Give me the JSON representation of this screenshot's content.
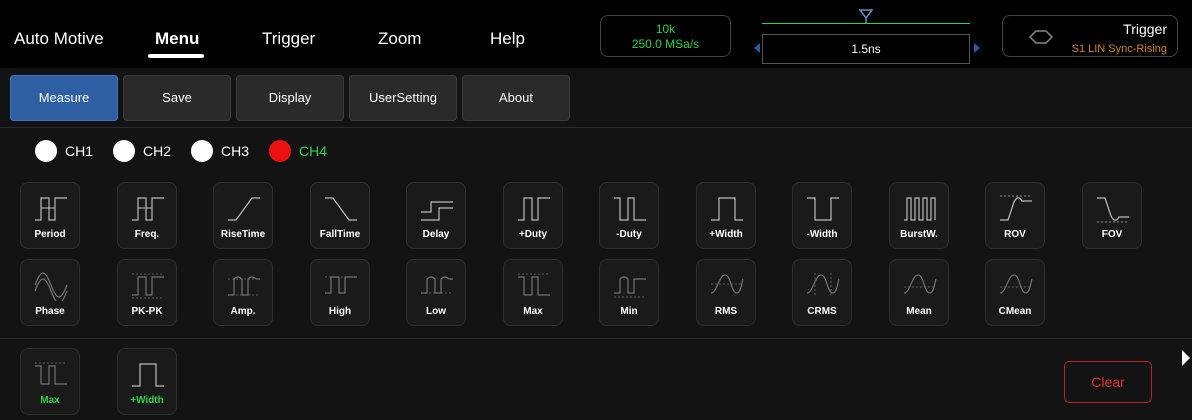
{
  "topnav": {
    "app": "Auto Motive",
    "menu": "Menu",
    "trigger": "Trigger",
    "zoom": "Zoom",
    "help": "Help"
  },
  "acquisition": {
    "points": "10k",
    "sample_rate": "250.0 MSa/s"
  },
  "timebase": {
    "value": "1.5ns"
  },
  "trigger_panel": {
    "title": "Trigger",
    "source": "S1 LIN Sync-Rising"
  },
  "tabs": [
    "Measure",
    "Save",
    "Display",
    "UserSetting",
    "About"
  ],
  "active_tab": "Measure",
  "channels": [
    {
      "label": "CH1",
      "color": "#ffffff",
      "active": false
    },
    {
      "label": "CH2",
      "color": "#ffffff",
      "active": false
    },
    {
      "label": "CH3",
      "color": "#ffffff",
      "active": false
    },
    {
      "label": "CH4",
      "color": "#ee1111",
      "active": true
    }
  ],
  "measure_row1": [
    {
      "label": "Period",
      "icon": "period-icon"
    },
    {
      "label": "Freq.",
      "icon": "frequency-icon"
    },
    {
      "label": "RiseTime",
      "icon": "rise-time-icon"
    },
    {
      "label": "FallTime",
      "icon": "fall-time-icon"
    },
    {
      "label": "Delay",
      "icon": "delay-icon"
    },
    {
      "label": "+Duty",
      "icon": "positive-duty-icon"
    },
    {
      "label": "-Duty",
      "icon": "negative-duty-icon"
    },
    {
      "label": "+Width",
      "icon": "positive-width-icon"
    },
    {
      "label": "-Width",
      "icon": "negative-width-icon"
    },
    {
      "label": "BurstW.",
      "icon": "burst-width-icon"
    },
    {
      "label": "ROV",
      "icon": "rise-overshoot-icon"
    },
    {
      "label": "FOV",
      "icon": "fall-overshoot-icon"
    }
  ],
  "measure_row2": [
    {
      "label": "Phase",
      "icon": "phase-icon"
    },
    {
      "label": "PK-PK",
      "icon": "peak-to-peak-icon"
    },
    {
      "label": "Amp.",
      "icon": "amplitude-icon"
    },
    {
      "label": "High",
      "icon": "high-icon"
    },
    {
      "label": "Low",
      "icon": "low-icon"
    },
    {
      "label": "Max",
      "icon": "max-icon"
    },
    {
      "label": "Min",
      "icon": "min-icon"
    },
    {
      "label": "RMS",
      "icon": "rms-icon"
    },
    {
      "label": "CRMS",
      "icon": "cycle-rms-icon"
    },
    {
      "label": "Mean",
      "icon": "mean-icon"
    },
    {
      "label": "CMean",
      "icon": "cycle-mean-icon"
    }
  ],
  "selected_measures": [
    {
      "label": "Max",
      "icon": "max-icon"
    },
    {
      "label": "+Width",
      "icon": "positive-width-icon"
    }
  ],
  "clear_label": "Clear",
  "colors": {
    "accent_blue": "#2d5fa2",
    "selected_green": "#2fd44a",
    "clear_red": "#e03030",
    "trigger_orange": "#d08a1e"
  }
}
